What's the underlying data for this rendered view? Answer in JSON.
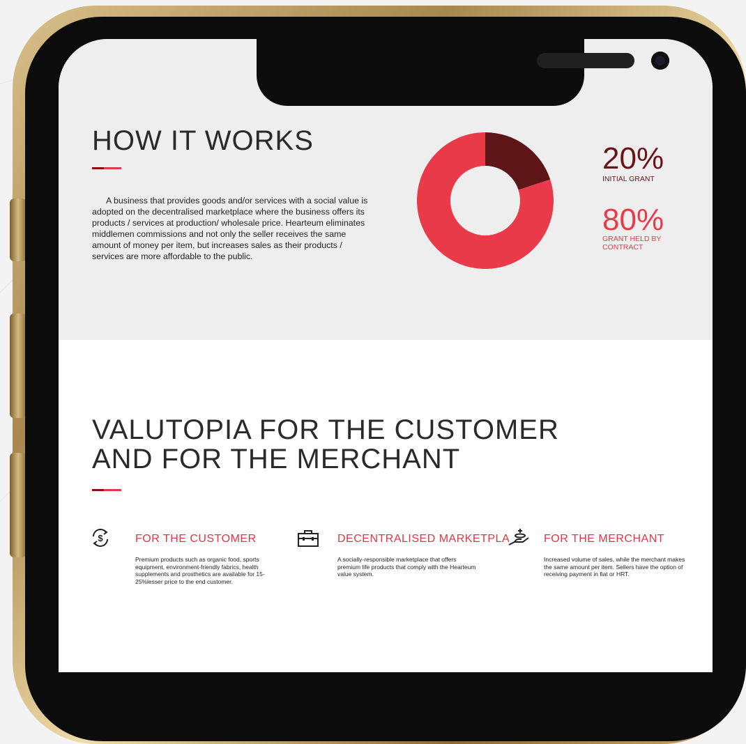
{
  "how_it_works": {
    "title": "HOW IT WORKS",
    "description": "A business that provides goods and/or services with a social value is adopted on the decentralised marketplace where the business offers its products / services at production/ wholesale price. Hearteum eliminates middlemen commissions and not only the seller receives the same amount of money per item, but increases sales as their products / services are more affordable to the public."
  },
  "chart_data": {
    "type": "pie",
    "title": "",
    "slices": [
      {
        "name": "INITIAL GRANT",
        "value": 20,
        "color": "#5e1518"
      },
      {
        "name": "GRANT HELD BY CONTRACT",
        "value": 80,
        "color": "#e83a48"
      }
    ]
  },
  "stats": [
    {
      "value": "20%",
      "label": "INITIAL GRANT",
      "color": "#6a1418"
    },
    {
      "value": "80%",
      "label": "GRANT HELD BY CONTRACT",
      "color": "#e83a48"
    }
  ],
  "valutopia": {
    "title_line1": "VALUTOPIA FOR THE CUSTOMER",
    "title_line2": "AND FOR THE MERCHANT"
  },
  "columns": [
    {
      "icon": "dollar-exchange-icon",
      "title": "FOR THE CUSTOMER",
      "text": "Premium products such as organic food, sports equipment, environment-friendly fabrics, health supplements and prosthetics are available for 15-25%lesser price to the end customer."
    },
    {
      "icon": "briefcase-icon",
      "title": "DECENTRALISED MARKETPLACE",
      "text": "A socially-responsible marketplace that offers premium life products that comply with the Hearteum value system."
    },
    {
      "icon": "hand-coins-icon",
      "title": "FOR THE MERCHANT",
      "text": "Increased volume of sales, while the merchant makes the same amount per item. Sellers have the option of receiving payment in fiat or HRT."
    }
  ],
  "colors": {
    "accent": "#e83a48",
    "dark_accent": "#6a1418",
    "gold_frame": "#c9a866"
  }
}
